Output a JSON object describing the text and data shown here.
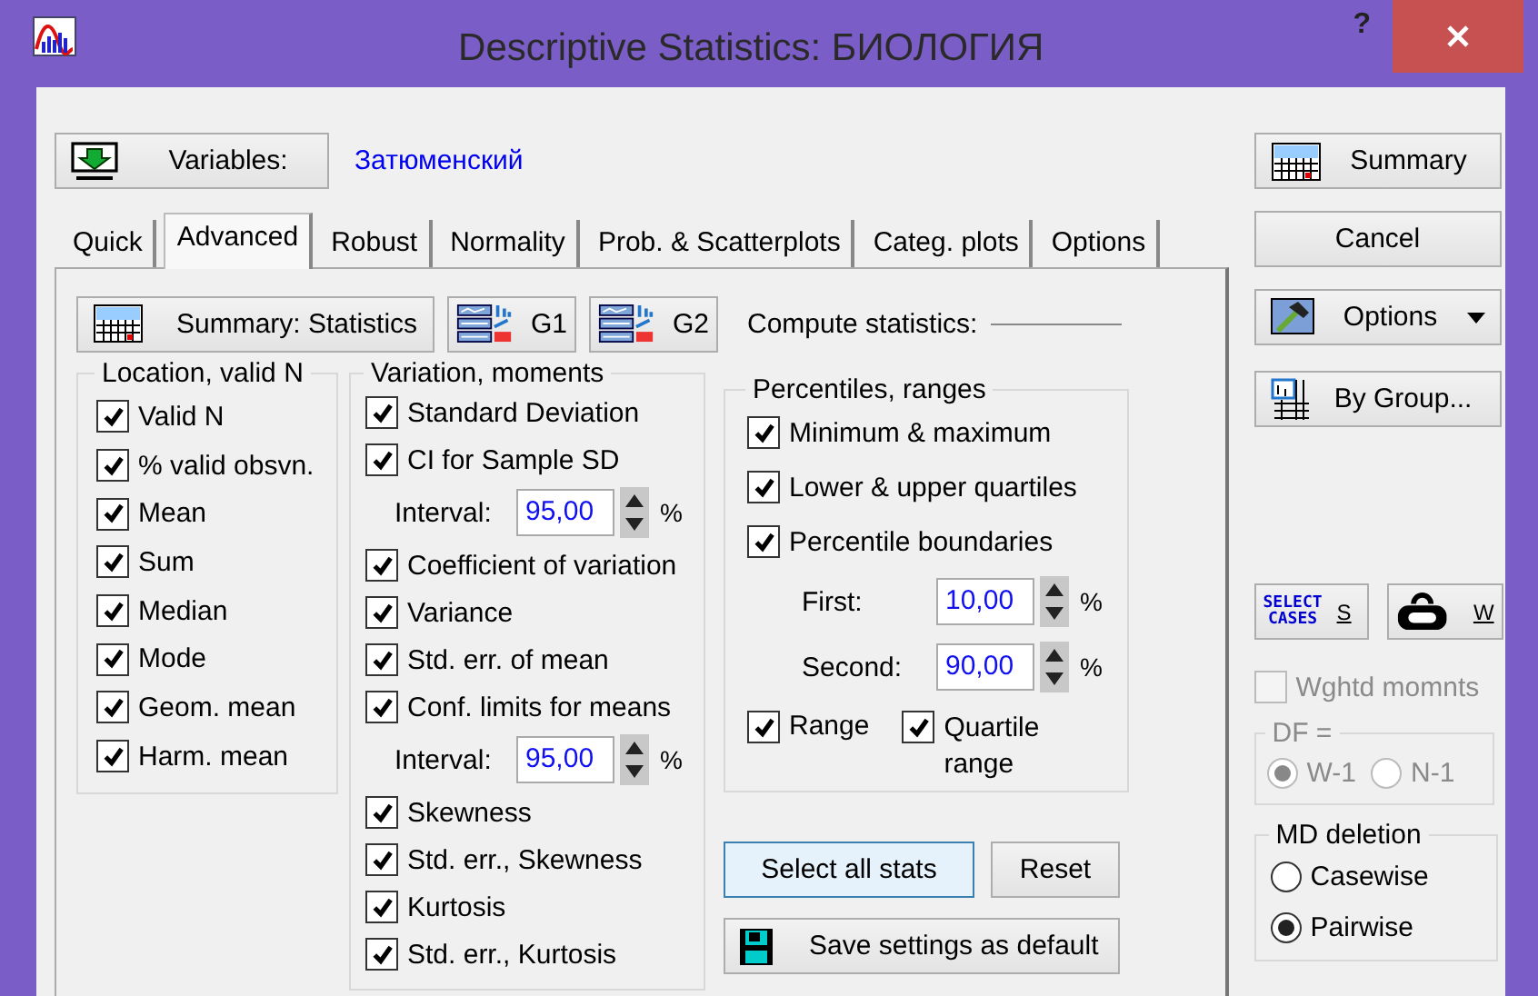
{
  "window": {
    "title": "Descriptive Statistics: БИОЛОГИЯ",
    "help": "?"
  },
  "variables": {
    "button": "Variables:",
    "value": "Затюменский"
  },
  "tabs": [
    {
      "label": "Quick",
      "selected": false
    },
    {
      "label": "Advanced",
      "selected": true
    },
    {
      "label": "Robust",
      "selected": false
    },
    {
      "label": "Normality",
      "selected": false
    },
    {
      "label": "Prob. & Scatterplots",
      "selected": false
    },
    {
      "label": "Categ. plots",
      "selected": false
    },
    {
      "label": "Options",
      "selected": false
    }
  ],
  "toolbar": {
    "summary_button": "Summary: Statistics",
    "g1_button": "G1",
    "g2_button": "G2",
    "compute_label": "Compute statistics:"
  },
  "groups": [
    {
      "title": "Location, valid N",
      "items": [
        {
          "kind": "checkbox",
          "label": "Valid N",
          "checked": true
        },
        {
          "kind": "checkbox",
          "label": "% valid obsvn.",
          "checked": true
        },
        {
          "kind": "checkbox",
          "label": "Mean",
          "checked": true
        },
        {
          "kind": "checkbox",
          "label": "Sum",
          "checked": true
        },
        {
          "kind": "checkbox",
          "label": "Median",
          "checked": true
        },
        {
          "kind": "checkbox",
          "label": "Mode",
          "checked": true
        },
        {
          "kind": "checkbox",
          "label": "Geom. mean",
          "checked": true
        },
        {
          "kind": "checkbox",
          "label": "Harm. mean",
          "checked": true
        }
      ]
    },
    {
      "title": "Variation, moments",
      "items": [
        {
          "kind": "checkbox",
          "label": "Standard Deviation",
          "checked": true
        },
        {
          "kind": "checkbox",
          "label": "CI for Sample SD",
          "checked": true
        },
        {
          "kind": "spin",
          "label": "Interval:",
          "value": "95,00",
          "unit": "%"
        },
        {
          "kind": "checkbox",
          "label": "Coefficient of variation",
          "checked": true
        },
        {
          "kind": "checkbox",
          "label": "Variance",
          "checked": true
        },
        {
          "kind": "checkbox",
          "label": "Std. err. of mean",
          "checked": true
        },
        {
          "kind": "checkbox",
          "label": "Conf. limits for means",
          "checked": true
        },
        {
          "kind": "spin",
          "label": "Interval:",
          "value": "95,00",
          "unit": "%"
        },
        {
          "kind": "checkbox",
          "label": "Skewness",
          "checked": true
        },
        {
          "kind": "checkbox",
          "label": "Std. err., Skewness",
          "checked": true
        },
        {
          "kind": "checkbox",
          "label": "Kurtosis",
          "checked": true
        },
        {
          "kind": "checkbox",
          "label": "Std. err., Kurtosis",
          "checked": true
        }
      ]
    },
    {
      "title": "Percentiles, ranges",
      "items": [
        {
          "kind": "checkbox",
          "label": "Minimum & maximum",
          "checked": true
        },
        {
          "kind": "checkbox",
          "label": "Lower & upper quartiles",
          "checked": true
        },
        {
          "kind": "checkbox",
          "label": "Percentile boundaries",
          "checked": true
        },
        {
          "kind": "spin",
          "label": "First:",
          "value": "10,00",
          "unit": "%"
        },
        {
          "kind": "spin",
          "label": "Second:",
          "value": "90,00",
          "unit": "%"
        },
        {
          "kind": "pair",
          "checkboxes": [
            {
              "label": "Range",
              "checked": true
            },
            {
              "label": "Quartile range",
              "checked": true
            }
          ]
        }
      ]
    }
  ],
  "actions": {
    "select_all": "Select all stats",
    "reset": "Reset",
    "save_default": "Save settings as default"
  },
  "side_buttons": [
    {
      "kind": "summary",
      "label": "Summary"
    },
    {
      "kind": "plain",
      "label": "Cancel"
    },
    {
      "kind": "options",
      "label": "Options"
    },
    {
      "kind": "bygroup",
      "label": "By Group..."
    }
  ],
  "case_buttons": [
    {
      "kind": "select_cases",
      "icon_lines": [
        "SELECT",
        "CASES"
      ],
      "label": "S"
    },
    {
      "kind": "weight",
      "label": "W"
    }
  ],
  "weighted": {
    "label": "Wghtd momnts",
    "checked": false,
    "disabled": true
  },
  "df": {
    "title": "DF =",
    "disabled": true,
    "options": [
      {
        "label": "W-1",
        "selected": true
      },
      {
        "label": "N-1",
        "selected": false
      }
    ]
  },
  "md_deletion": {
    "title": "MD deletion",
    "options": [
      {
        "label": "Casewise",
        "selected": false
      },
      {
        "label": "Pairwise",
        "selected": true
      }
    ]
  }
}
